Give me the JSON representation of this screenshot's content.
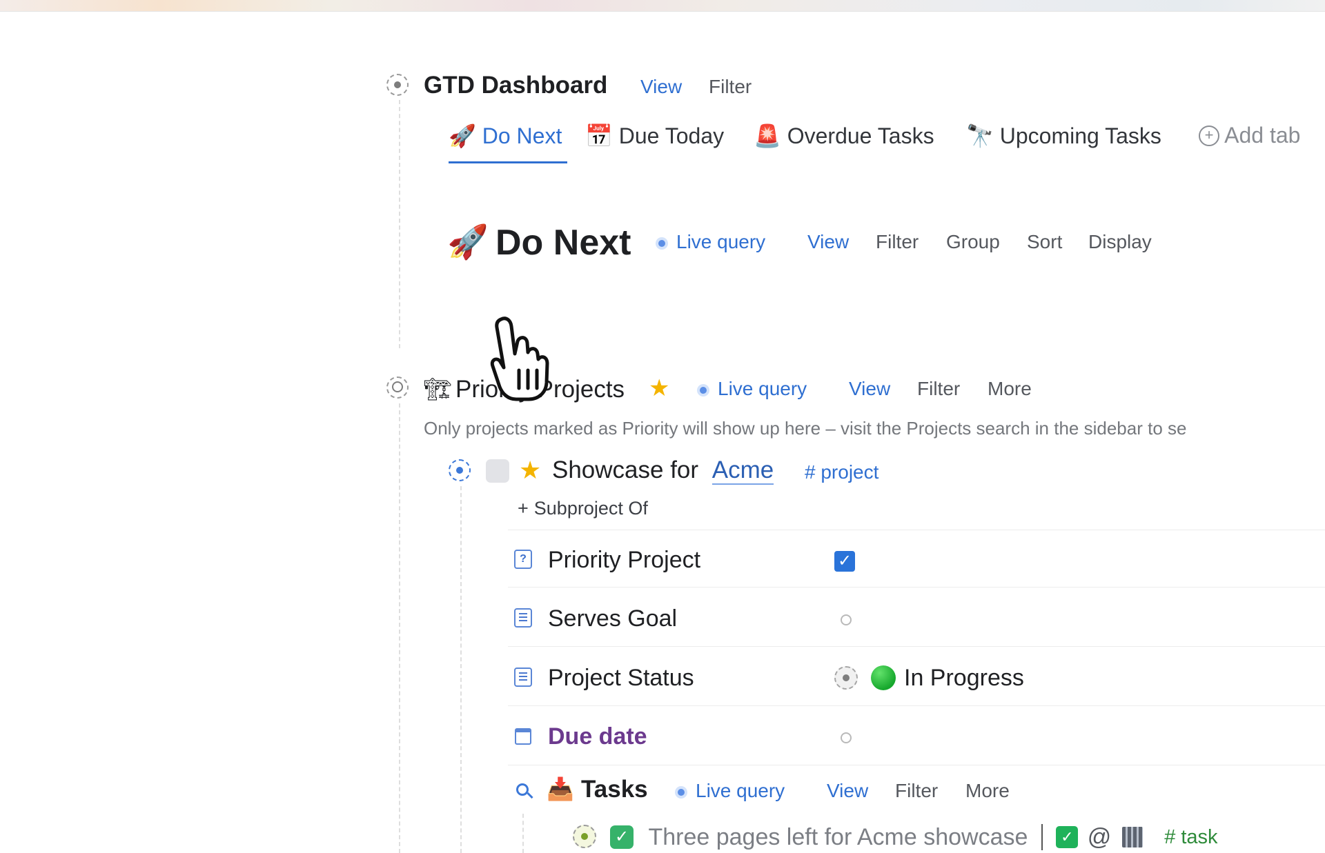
{
  "colors": {
    "accent": "#2f6fd1",
    "text": "#1f2023",
    "muted": "#55585e",
    "purple": "#6c3a8e",
    "green": "#1fb25a"
  },
  "dashboard": {
    "title": "GTD Dashboard",
    "view_label": "View",
    "filter_label": "Filter",
    "tabs": [
      {
        "icon": "rocket-icon",
        "label": "Do Next",
        "active": true
      },
      {
        "icon": "calendar-icon",
        "label": "Due Today",
        "active": false
      },
      {
        "icon": "siren-icon",
        "label": "Overdue Tasks",
        "active": false
      },
      {
        "icon": "telescope-icon",
        "label": "Upcoming Tasks",
        "active": false
      }
    ],
    "add_tab_label": "Add tab"
  },
  "do_next": {
    "title": "Do Next",
    "icon": "rocket-icon",
    "live_query_label": "Live query",
    "actions": [
      "View",
      "Filter",
      "Group",
      "Sort",
      "Display"
    ]
  },
  "priority_projects": {
    "title": "Priority Projects",
    "icon": "construction-icon",
    "star_icon": "star-icon",
    "live_query_label": "Live query",
    "actions": [
      "View",
      "Filter",
      "More"
    ],
    "description": "Only projects marked as Priority will show up here – visit the Projects search in the sidebar to se"
  },
  "project": {
    "title_prefix": "Showcase for",
    "title_link": "Acme",
    "tag": "# project",
    "subproject_label": "Subproject Of",
    "properties": [
      {
        "icon": "question-box-icon",
        "label": "Priority Project",
        "value_type": "checkbox",
        "checked": true
      },
      {
        "icon": "list-icon",
        "label": "Serves Goal",
        "value_type": "empty"
      },
      {
        "icon": "list-icon",
        "label": "Project Status",
        "value_type": "status",
        "value": "In Progress"
      },
      {
        "icon": "calendar-icon",
        "label": "Due date",
        "value_type": "empty"
      }
    ]
  },
  "tasks": {
    "title": "Tasks",
    "icon": "inbox-tray-icon",
    "live_query_label": "Live query",
    "actions": [
      "View",
      "Filter",
      "More"
    ],
    "items": [
      {
        "text": "Three pages left for Acme showcase",
        "tag": "# task",
        "context_symbol": "@"
      }
    ]
  }
}
